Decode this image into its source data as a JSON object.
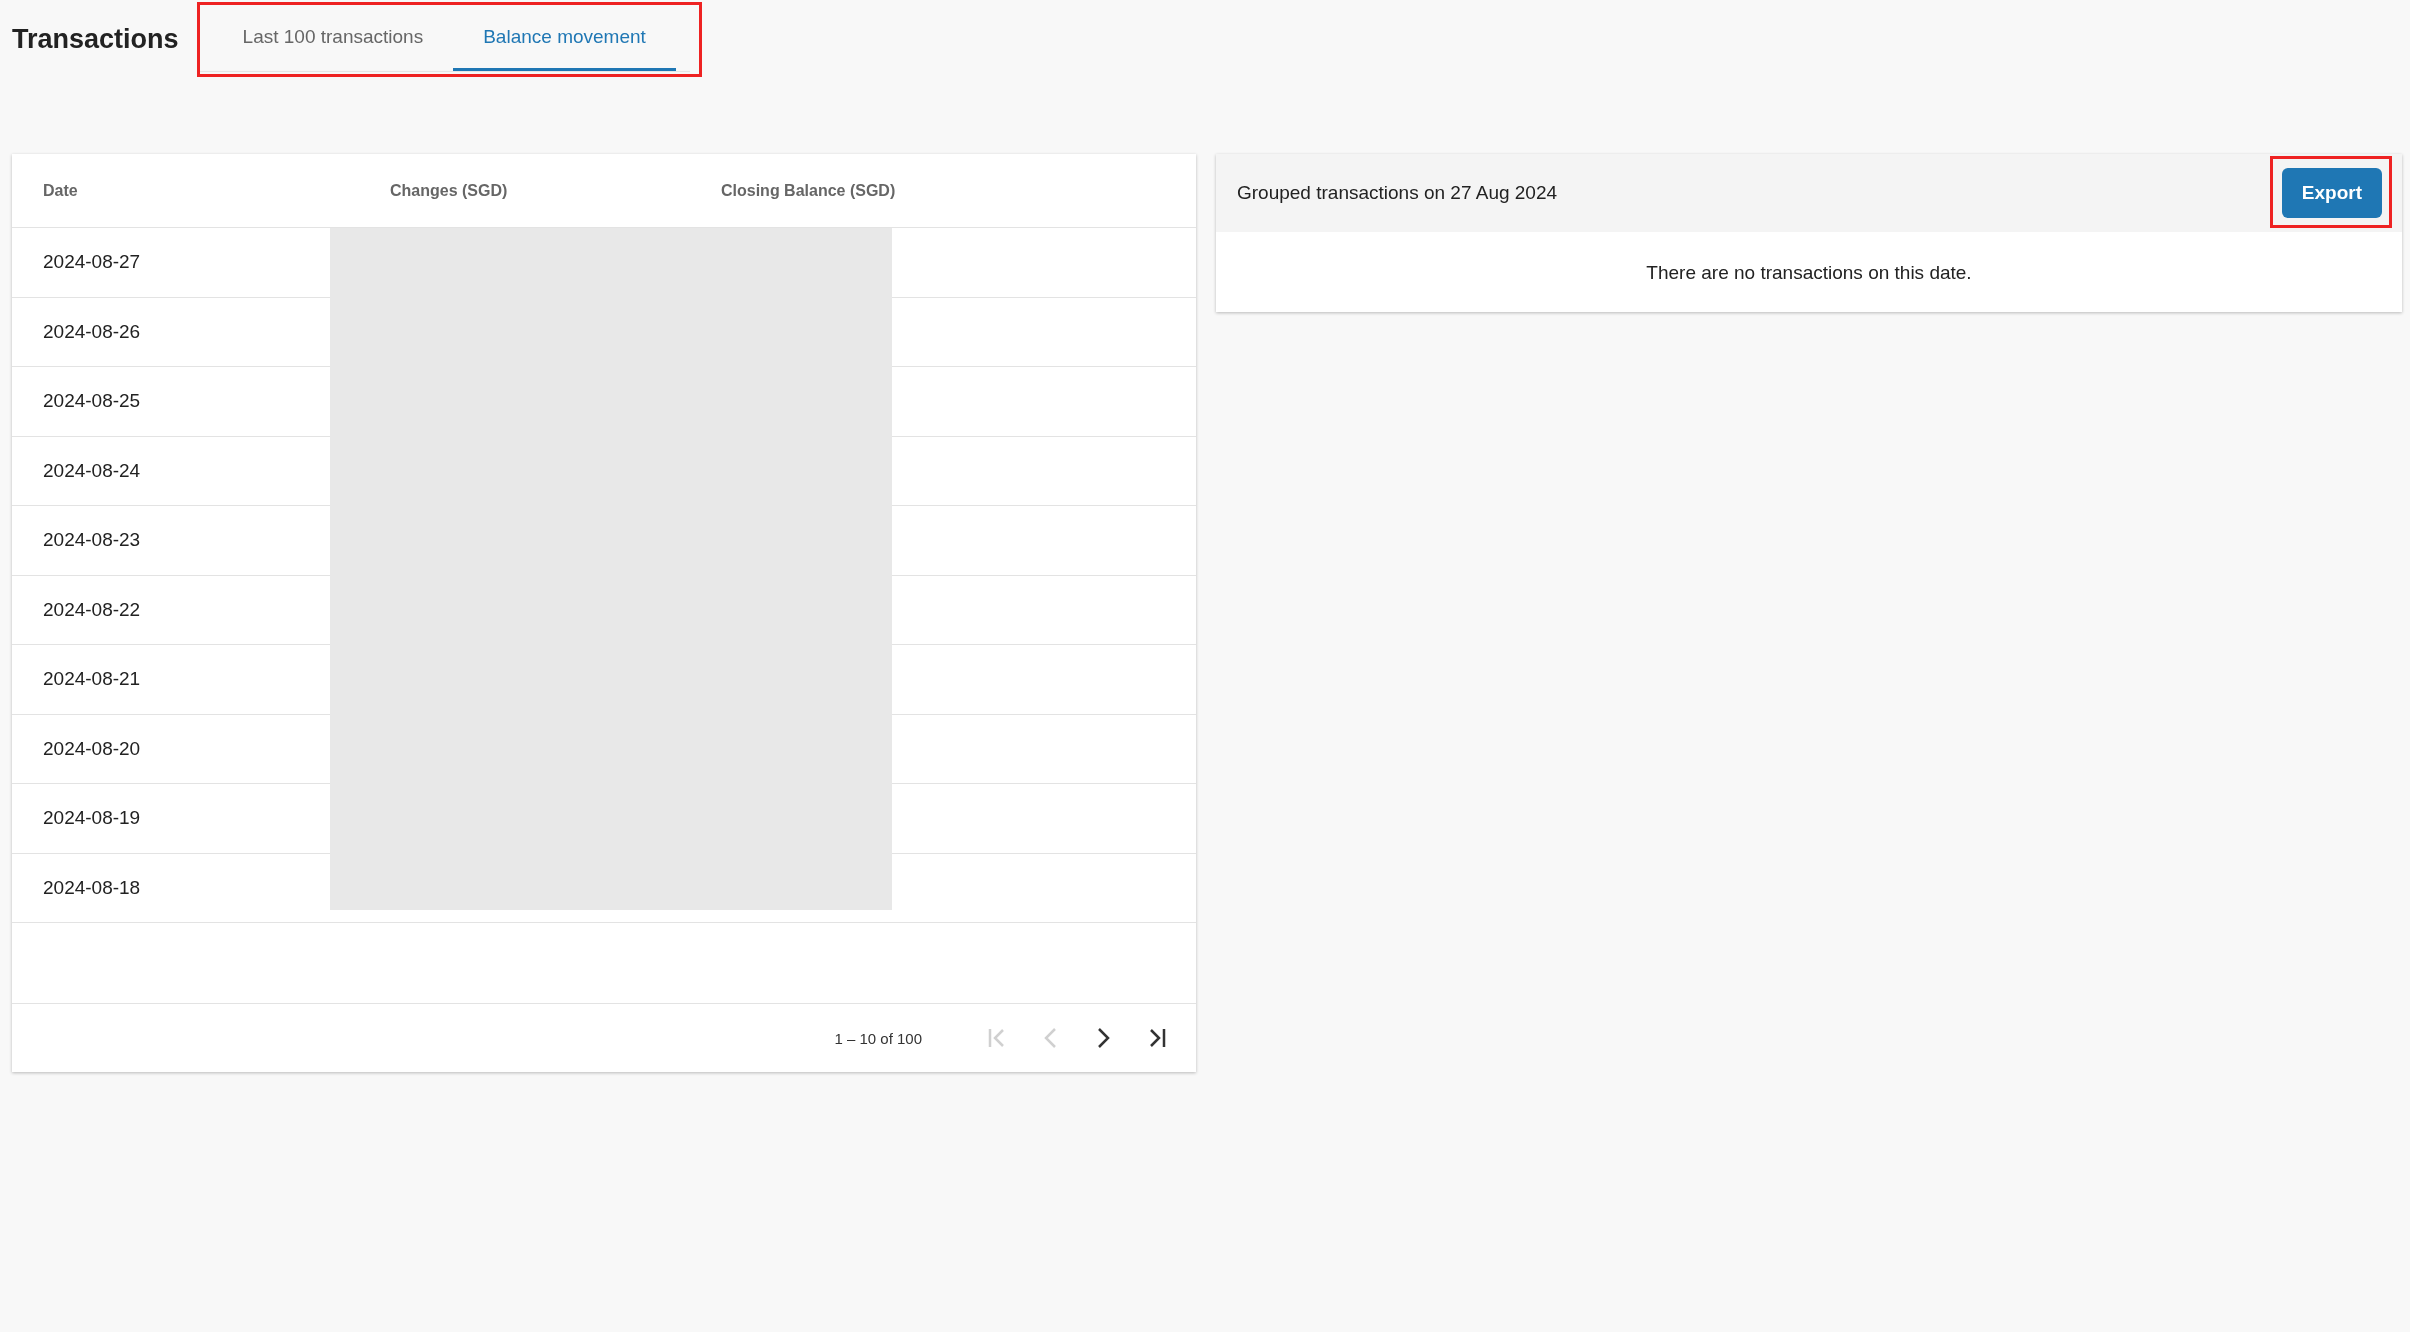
{
  "page": {
    "title": "Transactions"
  },
  "tabs": [
    {
      "label": "Last 100 transactions",
      "selected": false
    },
    {
      "label": "Balance movement",
      "selected": true
    }
  ],
  "table": {
    "columns": [
      "Date",
      "Changes (SGD)",
      "Closing Balance (SGD)"
    ],
    "rows": [
      {
        "date": "2024-08-27"
      },
      {
        "date": "2024-08-26"
      },
      {
        "date": "2024-08-25"
      },
      {
        "date": "2024-08-24"
      },
      {
        "date": "2024-08-23"
      },
      {
        "date": "2024-08-22"
      },
      {
        "date": "2024-08-21"
      },
      {
        "date": "2024-08-20"
      },
      {
        "date": "2024-08-19"
      },
      {
        "date": "2024-08-18"
      }
    ],
    "pagination": {
      "range": "1 – 10 of 100",
      "buttons": [
        {
          "kind": "first",
          "disabled": true
        },
        {
          "kind": "prev",
          "disabled": true
        },
        {
          "kind": "next",
          "disabled": false
        },
        {
          "kind": "last",
          "disabled": false
        }
      ]
    }
  },
  "detail": {
    "title": "Grouped transactions on 27 Aug 2024",
    "export_button": "Export",
    "message": "There are no transactions on this date."
  }
}
